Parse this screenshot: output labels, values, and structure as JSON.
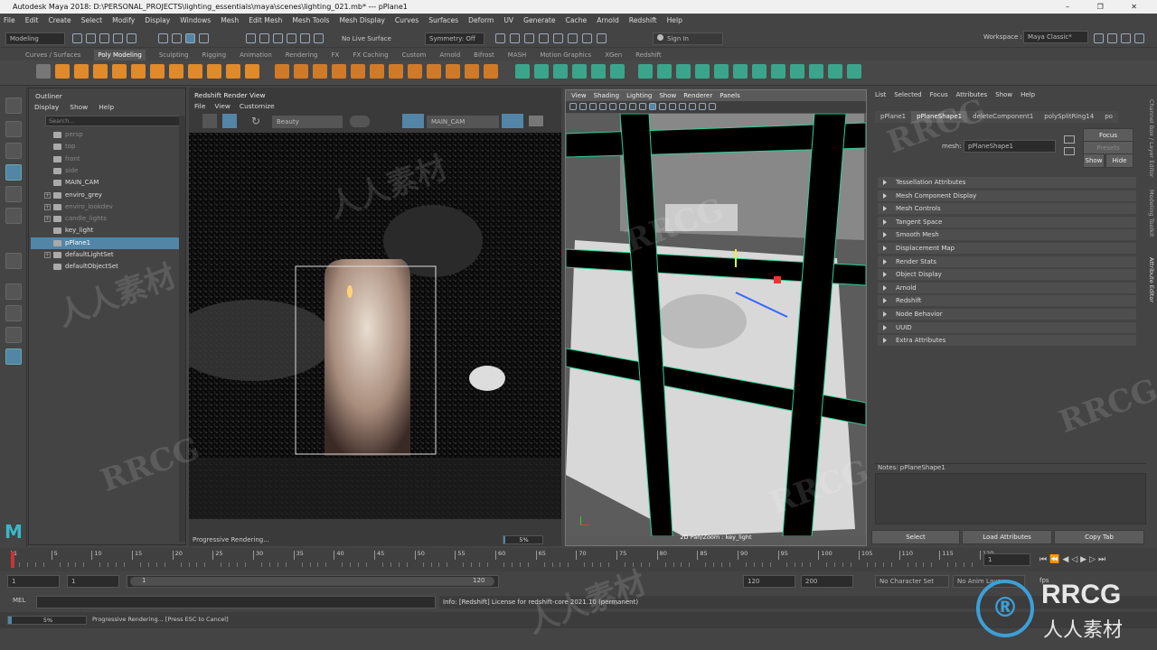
{
  "titlebar": {
    "title": "Autodesk Maya 2018: D:\\PERSONAL_PROJECTS\\lighting_essentials\\maya\\scenes\\lighting_021.mb*   ---   pPlane1",
    "controls": "–  ❐  ✕"
  },
  "menubar": [
    "File",
    "Edit",
    "Create",
    "Select",
    "Modify",
    "Display",
    "Windows",
    "Mesh",
    "Edit Mesh",
    "Mesh Tools",
    "Mesh Display",
    "Curves",
    "Surfaces",
    "Deform",
    "UV",
    "Generate",
    "Cache",
    "Arnold",
    "Redshift",
    "Help"
  ],
  "status": {
    "mode": "Modeling",
    "live_surface": "No Live Surface",
    "symmetry": "Symmetry: Off",
    "sign_in": "Sign In",
    "workspace_label": "Workspace :",
    "workspace": "Maya Classic*"
  },
  "shelf_tabs": [
    "Curves / Surfaces",
    "Poly Modeling",
    "Sculpting",
    "Rigging",
    "Animation",
    "Rendering",
    "FX",
    "FX Caching",
    "Custom",
    "Arnold",
    "Bifrost",
    "MASH",
    "Motion Graphics",
    "XGen",
    "Redshift"
  ],
  "shelf_active": "Poly Modeling",
  "outliner": {
    "title": "Outliner",
    "menu": [
      "Display",
      "Show",
      "Help"
    ],
    "search_placeholder": "Search...",
    "items": [
      {
        "label": "persp",
        "dim": true,
        "plus": false
      },
      {
        "label": "top",
        "dim": true,
        "plus": false
      },
      {
        "label": "front",
        "dim": true,
        "plus": false
      },
      {
        "label": "side",
        "dim": true,
        "plus": false
      },
      {
        "label": "MAIN_CAM",
        "dim": false,
        "plus": false
      },
      {
        "label": "enviro_grey",
        "dim": false,
        "plus": true
      },
      {
        "label": "enviro_lookdev",
        "dim": true,
        "plus": true
      },
      {
        "label": "candle_lights",
        "dim": true,
        "plus": true
      },
      {
        "label": "key_light",
        "dim": false,
        "plus": false
      },
      {
        "label": "pPlane1",
        "dim": false,
        "plus": false,
        "selected": true
      },
      {
        "label": "defaultLightSet",
        "dim": false,
        "plus": true
      },
      {
        "label": "defaultObjectSet",
        "dim": false,
        "plus": false
      }
    ]
  },
  "redshift_view": {
    "title": "Redshift Render View",
    "menu": [
      "File",
      "View",
      "Customize"
    ],
    "aov": "Beauty",
    "camera": "MAIN_CAM",
    "status": "Progressive Rendering...",
    "progress_label": "5%",
    "progress": 0.05
  },
  "viewport": {
    "menu": [
      "View",
      "Shading",
      "Lighting",
      "Show",
      "Renderer",
      "Panels"
    ],
    "hud": "2D Pan/Zoom : key_light"
  },
  "attribute_editor": {
    "menu": [
      "List",
      "Selected",
      "Focus",
      "Attributes",
      "Show",
      "Help"
    ],
    "tabs": [
      "pPlane1",
      "pPlaneShape1",
      "deleteComponent1",
      "polySplitRing14",
      "po"
    ],
    "active_tab": "pPlaneShape1",
    "mesh_label": "mesh:",
    "mesh_value": "pPlaneShape1",
    "focus": "Focus",
    "presets": "Presets",
    "show": "Show",
    "hide": "Hide",
    "sections": [
      "Tessellation Attributes",
      "Mesh Component Display",
      "Mesh Controls",
      "Tangent Space",
      "Smooth Mesh",
      "Displacement Map",
      "Render Stats",
      "Object Display",
      "Arnold",
      "Redshift",
      "Node Behavior",
      "UUID",
      "Extra Attributes"
    ],
    "notes": "Notes:  pPlaneShape1",
    "buttons": [
      "Select",
      "Load Attributes",
      "Copy Tab"
    ]
  },
  "side_tabs": [
    "Channel Box / Layer Editor",
    "Modeling Toolkit",
    "Attribute Editor"
  ],
  "timeline": {
    "ticks": [
      "1",
      "5",
      "10",
      "15",
      "20",
      "25",
      "30",
      "35",
      "40",
      "45",
      "50",
      "55",
      "60",
      "65",
      "70",
      "75",
      "80",
      "85",
      "90",
      "95",
      "100",
      "105",
      "110",
      "115",
      "120"
    ],
    "current": "1"
  },
  "range": {
    "start": "1",
    "start2": "1",
    "slider_start": "1",
    "slider_end": "120",
    "end": "120",
    "end2": "200",
    "char_set": "No Character Set",
    "anim_layer": "No Anim Layer",
    "fps": "fps"
  },
  "cmd": {
    "label": "MEL",
    "info": "Info: [Redshift] License for redshift-core 2021.10 (permanent)"
  },
  "help": {
    "progress_label": "5%",
    "text": "Progressive Rendering... [Press ESC to Cancel]"
  },
  "watermarks": [
    "RRCG",
    "人人素材",
    "RRCG",
    "人人素材",
    "RRCG",
    "RRCG",
    "人人素材",
    "RRCG"
  ],
  "logo": {
    "text": "RRCG",
    "sub": "人人素材"
  },
  "colors": {
    "accent": "#5285a6",
    "shelf_orange": "#e08a2a",
    "shelf_teal": "#3aa58a"
  }
}
